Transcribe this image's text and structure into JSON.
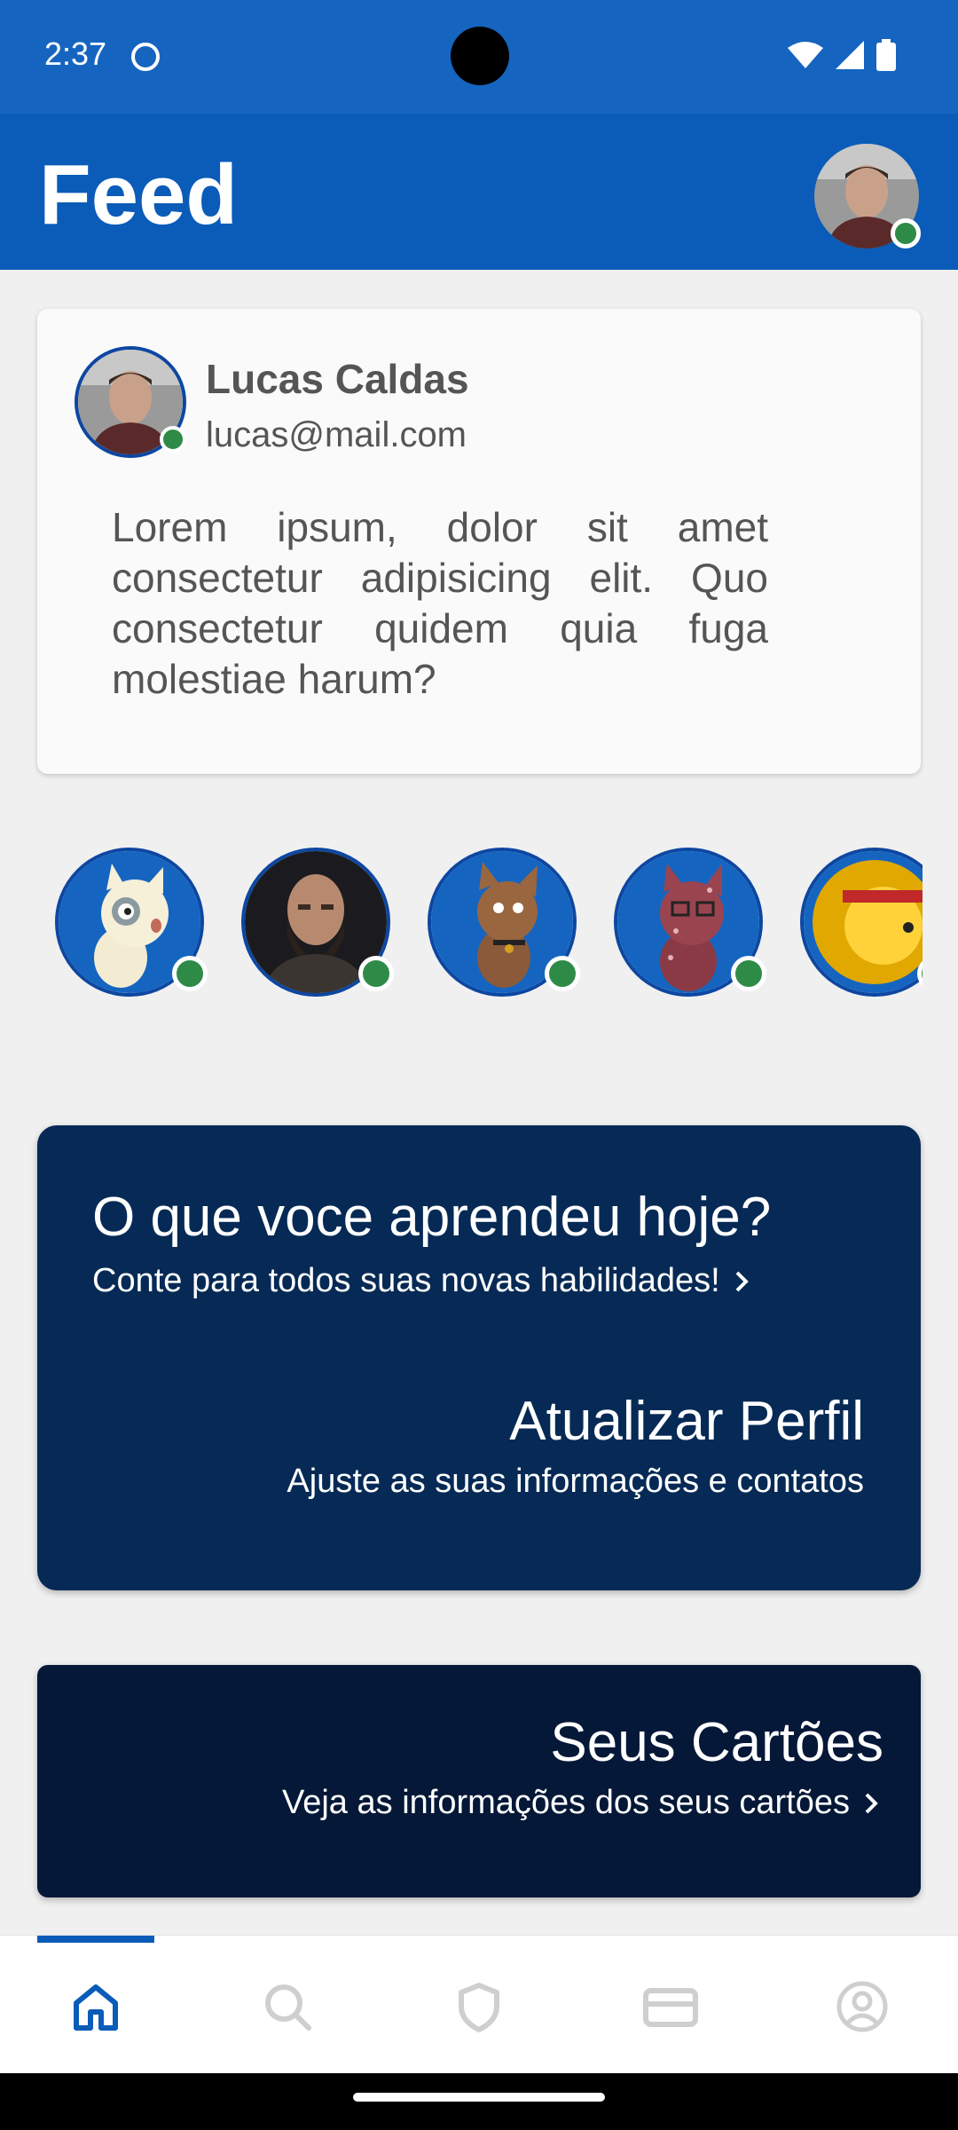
{
  "status_bar": {
    "time": "2:37",
    "icons": [
      "app-notification-icon",
      "wifi-icon",
      "signal-icon",
      "battery-icon"
    ],
    "background": "#1565c0"
  },
  "app_bar": {
    "title": "Feed",
    "background": "#0a5cb8"
  },
  "post": {
    "author_name": "Lucas Caldas",
    "author_email": "lucas@mail.com",
    "text": "Lorem ipsum, dolor sit amet consectetur adipisicing elit. Quo consectetur quidem quia fuga molestiae harum?"
  },
  "stories": [
    {
      "avatar": "cream-cat-avatar",
      "online": true
    },
    {
      "avatar": "bearded-man-avatar",
      "online": true
    },
    {
      "avatar": "brown-cat-avatar",
      "online": true
    },
    {
      "avatar": "spotted-cat-glasses-avatar",
      "online": true
    },
    {
      "avatar": "yellow-cat-headband-avatar",
      "online": true
    }
  ],
  "learn_card": {
    "title": "O que voce aprendeu hoje?",
    "subtitle": "Conte para todos suas novas habilidades!",
    "profile_title": "Atualizar Perfil",
    "profile_subtitle": "Ajuste as suas informações e contatos",
    "background": "#062a55"
  },
  "cards_card": {
    "title": "Seus Cartões",
    "subtitle": "Veja as informações dos seus cartões",
    "background": "#051838"
  },
  "bottom_nav": {
    "items": [
      "home-icon",
      "search-icon",
      "shield-icon",
      "card-icon",
      "account-icon"
    ],
    "active_index": 0,
    "active_color": "#0a5cb8",
    "inactive_color": "#cfcfcf"
  },
  "online_color": "#2e8b47"
}
